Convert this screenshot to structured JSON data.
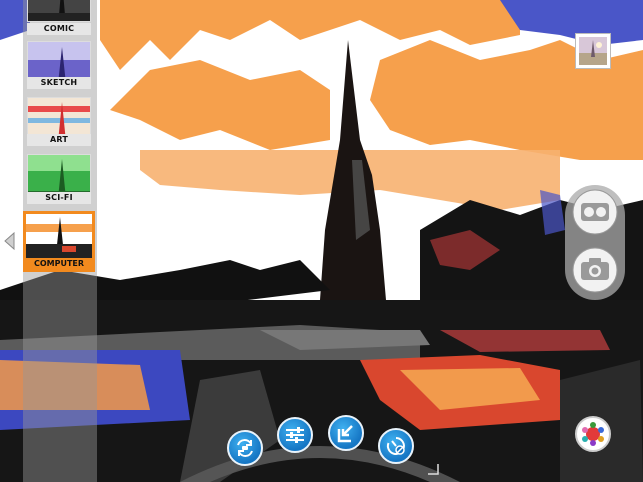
{
  "filters": {
    "items": [
      {
        "label": "COMIC",
        "selected": false
      },
      {
        "label": "SKETCH",
        "selected": false
      },
      {
        "label": "ART",
        "selected": false
      },
      {
        "label": "SCI-FI",
        "selected": false
      },
      {
        "label": "COMPUTER",
        "selected": true
      }
    ]
  },
  "icons": {
    "rail_toggle": "chevron-left-icon",
    "gallery": "gallery-thumbnail-icon",
    "video": "video-camera-icon",
    "photo": "camera-icon",
    "switch_camera": "switch-camera-icon",
    "adjust": "sliders-icon",
    "import": "import-icon",
    "timer": "timer-icon",
    "effects": "color-palette-icon",
    "expand": "chevron-down-right-icon"
  },
  "colors": {
    "accent": "#f28a1e",
    "tool_blue": "#1e88d8",
    "sky_orange": "#f6a04c"
  }
}
